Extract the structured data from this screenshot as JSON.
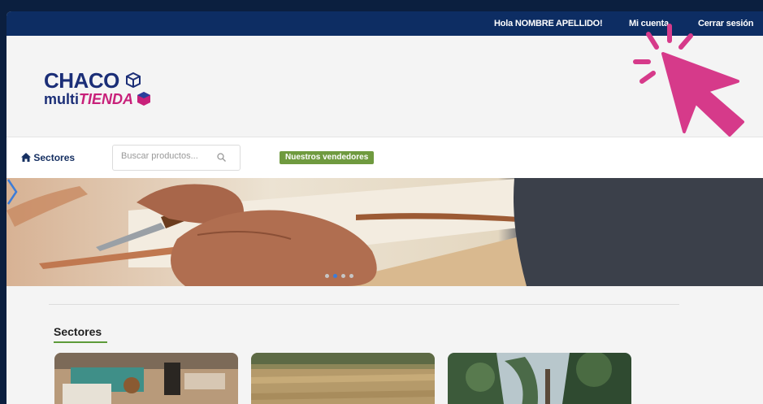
{
  "topbar": {
    "greeting": "Hola NOMBRE APELLIDO!",
    "account": "Mi cuenta",
    "logout": "Cerrar sesión"
  },
  "logo": {
    "line1": "CHACO",
    "multi": "multi",
    "tienda": "TIENDA"
  },
  "nav": {
    "sectores": "Sectores",
    "search_placeholder": "Buscar productos...",
    "vendors": "Nuestros vendedores"
  },
  "slider": {
    "slides": 4,
    "active": 2
  },
  "section": {
    "title": "Sectores"
  },
  "colors": {
    "topbar": "#0d2d63",
    "brand_blue": "#1b2e77",
    "brand_pink": "#c8207a",
    "vendors_button": "#6f9a3f",
    "pointer": "#d63a8a"
  },
  "icons": [
    "home-icon",
    "search-icon",
    "box-icon",
    "chevron-right-icon",
    "pointer-hand-icon"
  ]
}
